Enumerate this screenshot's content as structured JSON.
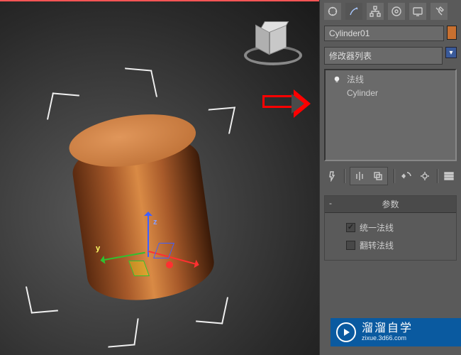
{
  "object_name": "Cylinder01",
  "modifier_list_label": "修改器列表",
  "stack": {
    "items": [
      {
        "label": "法线"
      },
      {
        "label": "Cylinder"
      }
    ]
  },
  "rollout": {
    "title": "参数",
    "unify_normals": "统一法线",
    "flip_normals": "翻转法线"
  },
  "watermark": {
    "brand": "溜溜自学",
    "url": "zixue.3d66.com"
  },
  "axis": {
    "y": "y",
    "z": "z"
  }
}
